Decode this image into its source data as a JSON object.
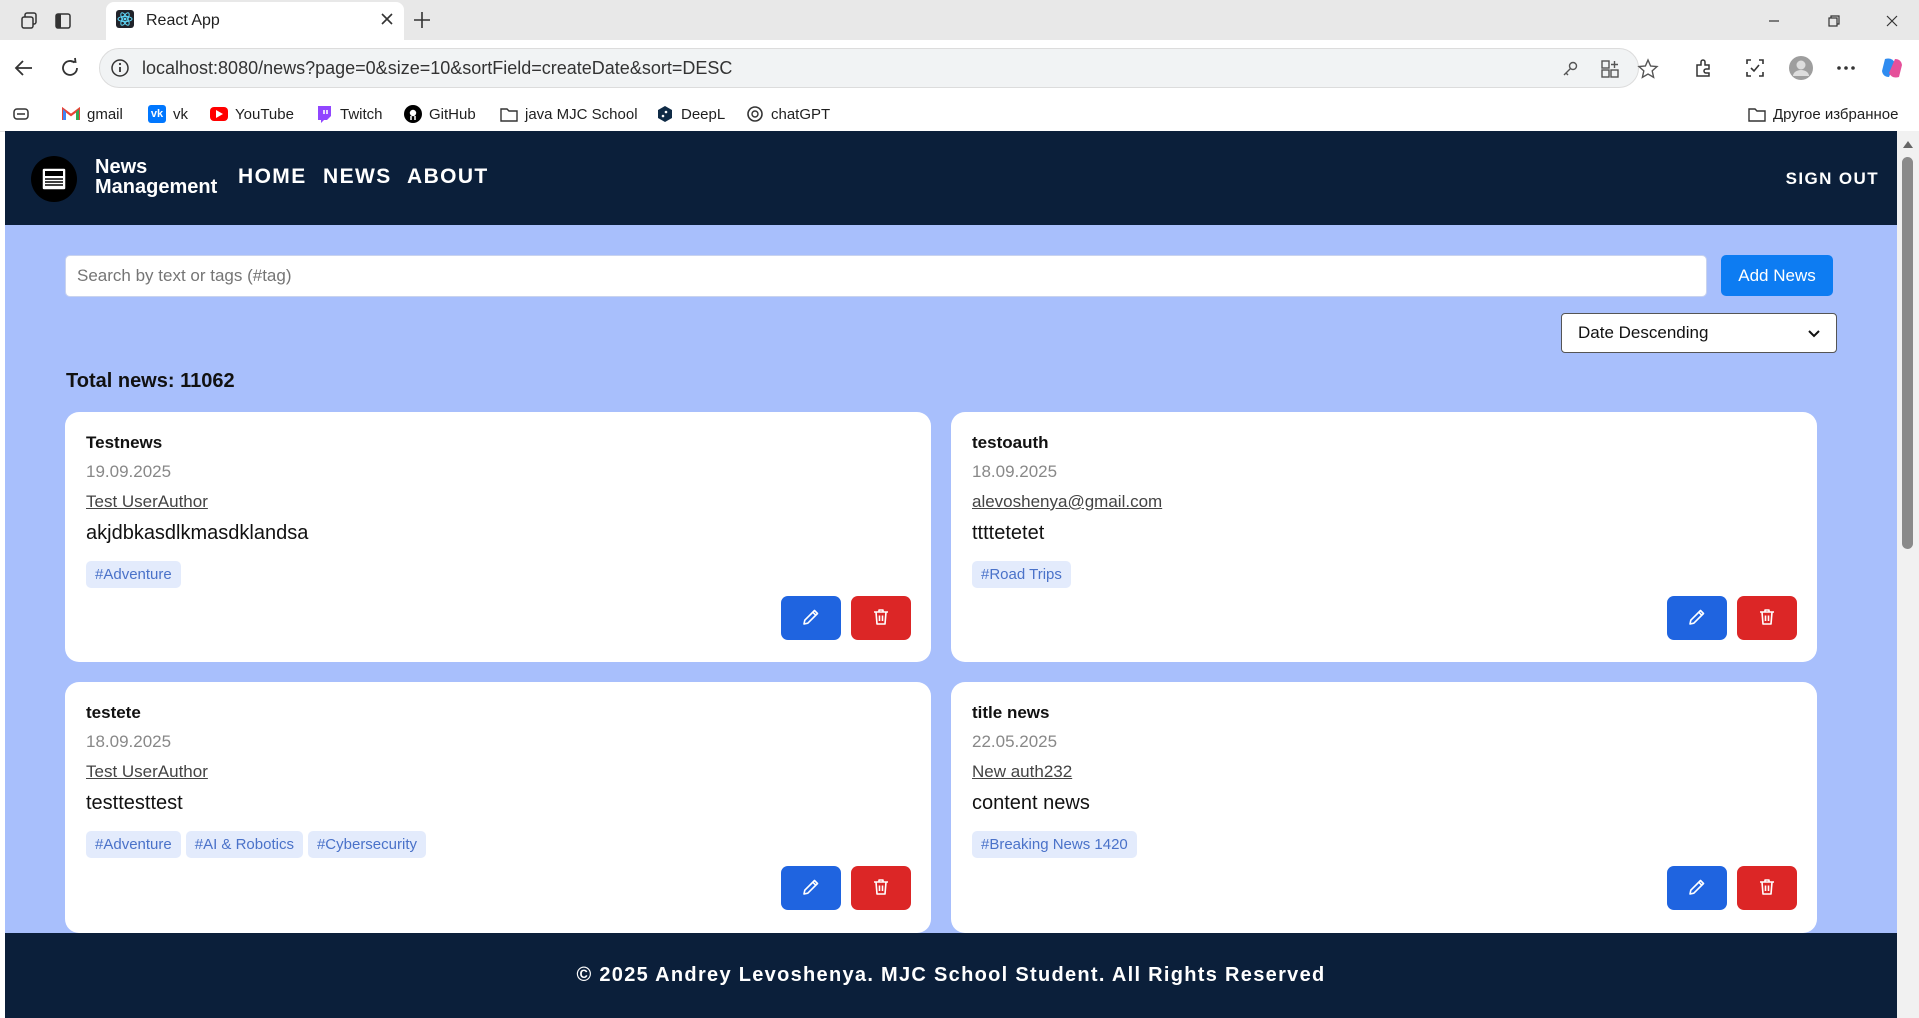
{
  "browser": {
    "tab_title": "React App",
    "url": "localhost:8080/news?page=0&size=10&sortField=createDate&sort=DESC",
    "bookmarks": [
      {
        "label": "gmail",
        "icon": "gmail-icon"
      },
      {
        "label": "vk",
        "icon": "vk-icon"
      },
      {
        "label": "YouTube",
        "icon": "youtube-icon"
      },
      {
        "label": "Twitch",
        "icon": "twitch-icon"
      },
      {
        "label": "GitHub",
        "icon": "github-icon"
      },
      {
        "label": "java MJC School",
        "icon": "folder-icon"
      },
      {
        "label": "DeepL",
        "icon": "deepl-icon"
      },
      {
        "label": "chatGPT",
        "icon": "chatgpt-icon"
      }
    ],
    "other_bookmarks": "Другое избранное"
  },
  "app": {
    "brand_line1": "News",
    "brand_line2": "Management",
    "nav": [
      "HOME",
      "NEWS",
      "ABOUT"
    ],
    "sign_out": "SIGN OUT",
    "search_placeholder": "Search by text or tags (#tag)",
    "add_news": "Add News",
    "sort_selected": "Date Descending",
    "total_news": "Total news: 11062",
    "footer": "© 2025 Andrey Levoshenya. MJC School Student. All Rights Reserved"
  },
  "news": [
    {
      "title": "Testnews",
      "date": "19.09.2025",
      "author": "Test UserAuthor",
      "content": "akjdbkasdlkmasdklandsa",
      "tags": [
        "#Adventure"
      ]
    },
    {
      "title": "testoauth",
      "date": "18.09.2025",
      "author": "alevoshenya@gmail.com",
      "content": "ttttetetet",
      "tags": [
        "#Road Trips"
      ]
    },
    {
      "title": "testete",
      "date": "18.09.2025",
      "author": "Test UserAuthor",
      "content": "testtesttest",
      "tags": [
        "#Adventure",
        "#AI & Robotics",
        "#Cybersecurity"
      ]
    },
    {
      "title": "title news",
      "date": "22.05.2025",
      "author": "New auth232",
      "content": "content news",
      "tags": [
        "#Breaking News 1420"
      ]
    }
  ],
  "colors": {
    "header_bg": "#0b1f3a",
    "page_bg": "#a8bffc",
    "primary_button": "#0d7cf2",
    "edit_button": "#1f64e0",
    "delete_button": "#dc2626",
    "tag_bg": "#e3ebfc",
    "tag_text": "#4a72c9"
  }
}
